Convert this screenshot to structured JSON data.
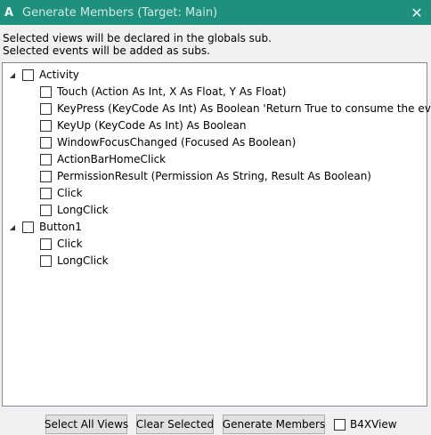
{
  "window": {
    "icon": "A",
    "title": "Generate Members (Target: Main)",
    "close": "✕"
  },
  "info": {
    "line1": "Selected views will be declared in the globals sub.",
    "line2": "Selected events will be added as subs."
  },
  "tree": {
    "activity": {
      "label": "Activity",
      "events": [
        "Touch (Action As Int, X As Float, Y As Float)",
        "KeyPress (KeyCode As Int) As Boolean 'Return True to consume the event",
        "KeyUp (KeyCode As Int) As Boolean",
        "WindowFocusChanged (Focused As Boolean)",
        "ActionBarHomeClick",
        "PermissionResult (Permission As String, Result As Boolean)",
        "Click",
        "LongClick"
      ]
    },
    "button1": {
      "label": "Button1",
      "events": [
        "Click",
        "LongClick"
      ]
    }
  },
  "buttons": {
    "select_all": "Select All Views",
    "clear_selected": "Clear Selected",
    "generate": "Generate Members",
    "b4xview": "B4XView"
  },
  "icons": {
    "expanded": "◢"
  }
}
